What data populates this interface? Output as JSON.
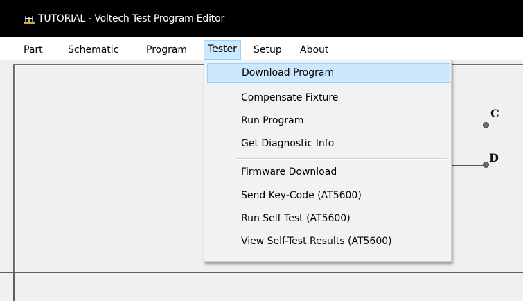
{
  "window": {
    "title": "TUTORIAL - Voltech Test Program Editor"
  },
  "menubar": {
    "items": [
      {
        "label": "Part"
      },
      {
        "label": "Schematic"
      },
      {
        "label": "Program"
      },
      {
        "label": "Tester"
      },
      {
        "label": "Setup"
      },
      {
        "label": "About"
      }
    ],
    "active": "Tester"
  },
  "tester_menu": {
    "items": [
      {
        "label": "Download Program",
        "highlighted": true
      },
      {
        "label": "Compensate Fixture"
      },
      {
        "label": "Run Program"
      },
      {
        "label": "Get Diagnostic Info"
      },
      {
        "label": "Firmware Download"
      },
      {
        "label": "Send Key-Code (AT5600)"
      },
      {
        "label": "Run Self Test (AT5600)"
      },
      {
        "label": "View Self-Test Results (AT5600)"
      }
    ]
  },
  "schematic": {
    "nodes": [
      {
        "label": "C"
      },
      {
        "label": "D"
      }
    ]
  },
  "icons": {
    "app": "voltech-app-icon"
  },
  "colors": {
    "titlebar": "#000000",
    "menu_highlight": "#cce8ff",
    "menu_highlight_border": "#99d1ff",
    "workspace": "#f0f0f0"
  }
}
